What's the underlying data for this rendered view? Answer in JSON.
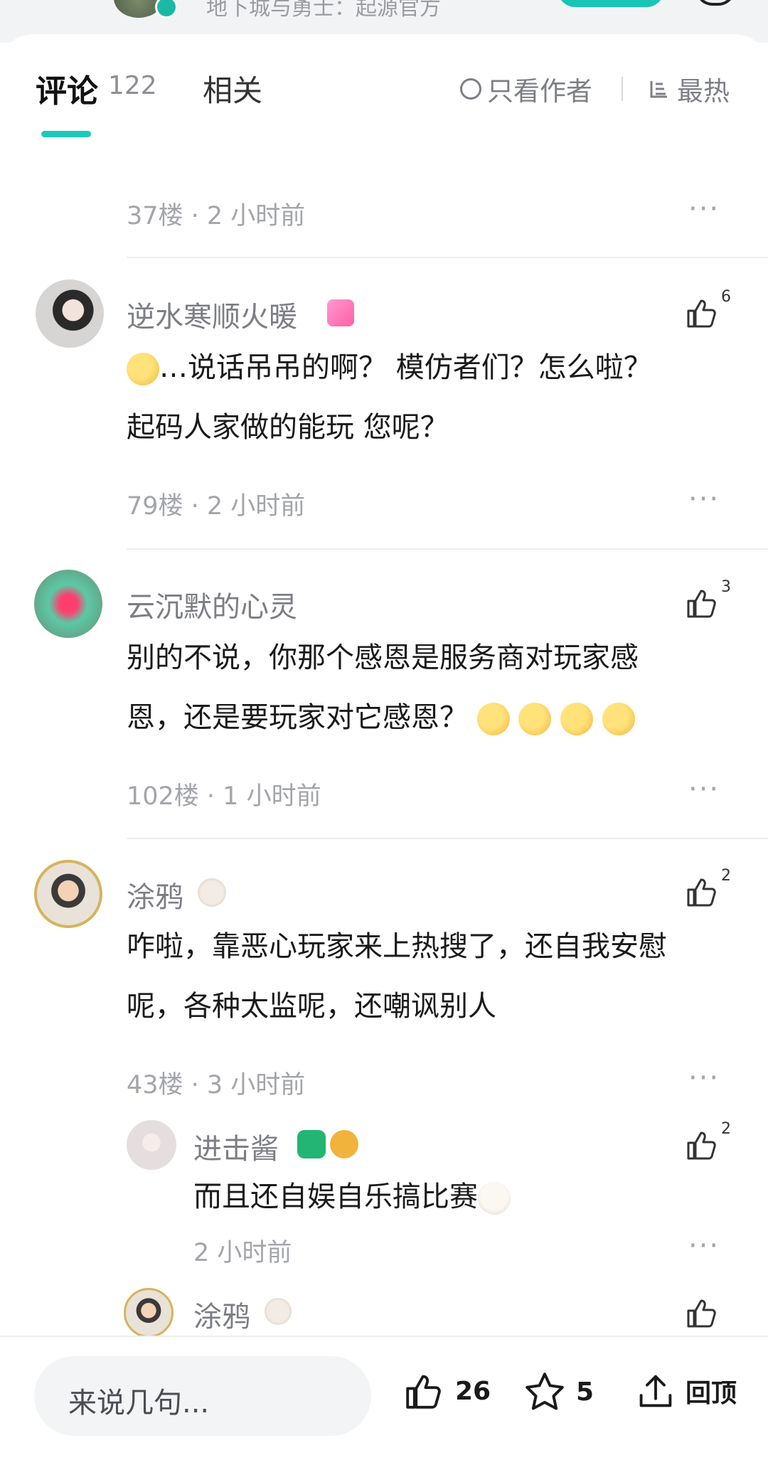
{
  "header": {
    "source_text": "地下城与勇士：起源官方"
  },
  "tabs": {
    "comments_label": "评论",
    "comments_count": "122",
    "related_label": "相关",
    "author_only_label": "只看作者",
    "hottest_label": "最热"
  },
  "comments": [
    {
      "meta": "37楼 · 2 小时前"
    },
    {
      "username": "逆水寒顺火暖",
      "likes": "6",
      "line1": "…说话吊吊的啊？ 模仿者们？怎么啦？",
      "line2": "起码人家做的能玩 您呢？",
      "meta": "79楼 · 2 小时前"
    },
    {
      "username": "云沉默的心灵",
      "likes": "3",
      "line1": "别的不说，你那个感恩是服务商对玩家感",
      "line2": "恩，还是要玩家对它感恩？",
      "meta": "102楼 · 1 小时前"
    },
    {
      "username": "涂鸦",
      "likes": "2",
      "line1": "咋啦，靠恶心玩家来上热搜了，还自我安慰",
      "line2": "呢，各种太监呢，还嘲讽别人",
      "meta": "43楼 · 3 小时前",
      "replies": [
        {
          "username": "进击酱",
          "likes": "2",
          "line1": "而且还自娱自乐搞比赛",
          "meta": "2 小时前"
        },
        {
          "username": "涂鸦"
        }
      ]
    }
  ],
  "more_dots": "···",
  "bottom_bar": {
    "compose_placeholder": "来说几句...",
    "like_count": "26",
    "favorite_count": "5",
    "back_to_top_label": "回顶"
  },
  "colors": {
    "accent": "#1cc9b8",
    "muted_text": "#a3a5aa",
    "username_text": "#7c7e83"
  }
}
